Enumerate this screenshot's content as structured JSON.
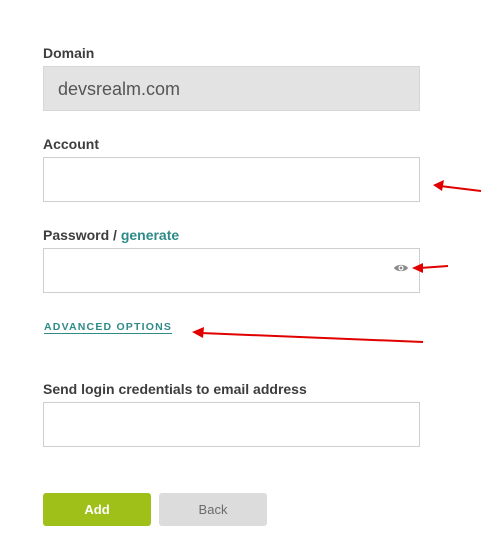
{
  "form": {
    "domain": {
      "label": "Domain",
      "value": "devsrealm.com"
    },
    "account": {
      "label": "Account",
      "value": ""
    },
    "password": {
      "label": "Password /",
      "generate_link": "generate",
      "value": "",
      "toggle_icon": "eye-icon"
    },
    "advanced_options_label": "ADVANCED OPTIONS",
    "email": {
      "label": "Send login credentials to email address",
      "value": ""
    },
    "buttons": {
      "add_label": "Add",
      "back_label": "Back"
    }
  },
  "colors": {
    "accent_link": "#2e8b88",
    "primary_button": "#9ec018",
    "secondary_button": "#dcdcdc",
    "annotation_arrow": "#e00000"
  }
}
